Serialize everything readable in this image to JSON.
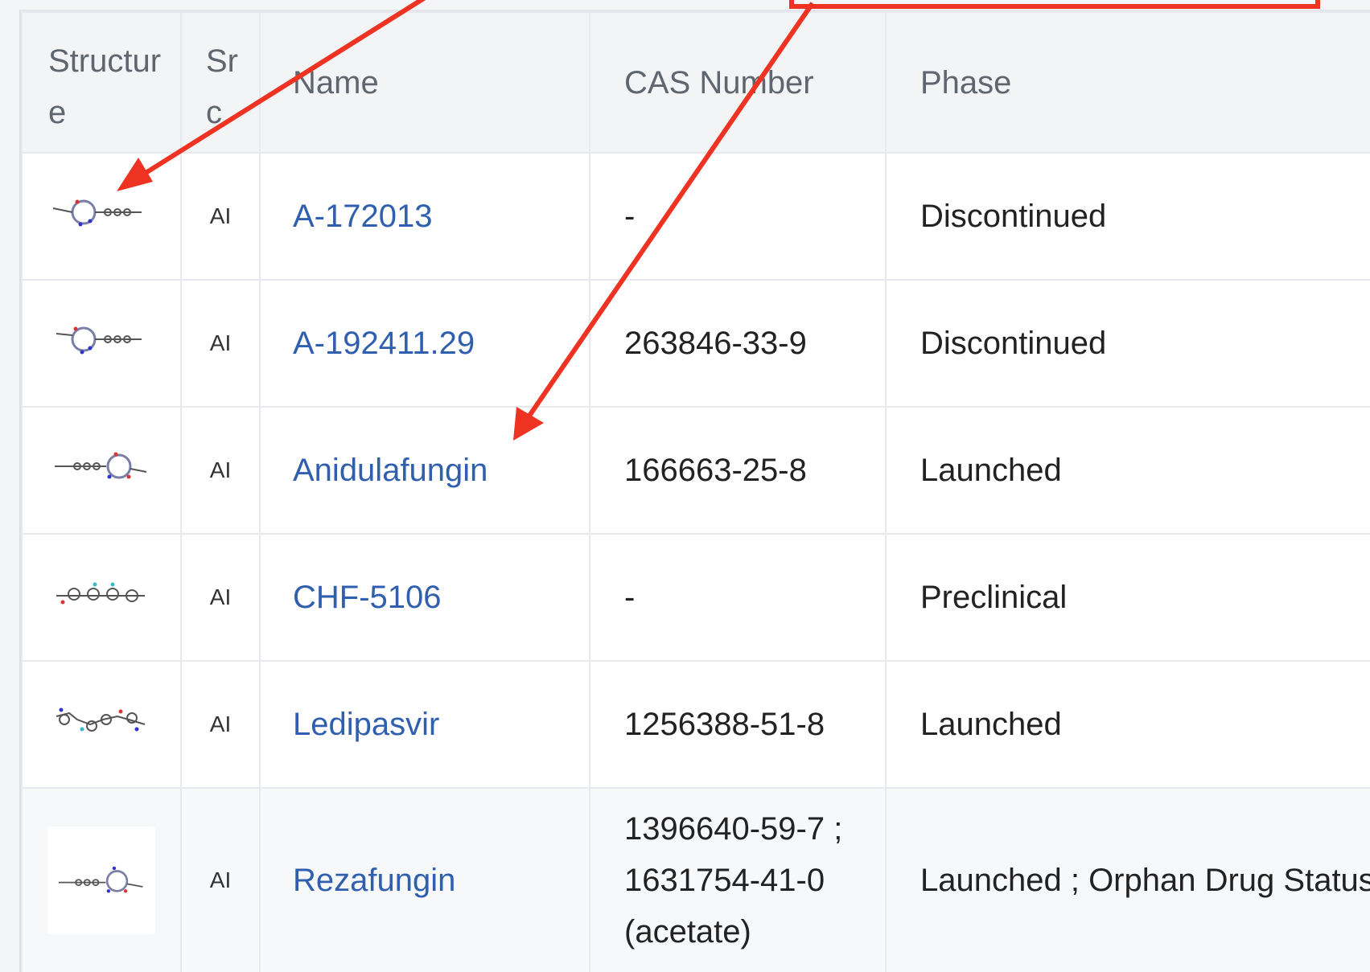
{
  "table": {
    "headers": {
      "structure": "Structure",
      "src": "Src",
      "name": "Name",
      "cas": "CAS Number",
      "phase": "Phase"
    },
    "rows": [
      {
        "src": "AI",
        "name": "A-172013",
        "cas": "-",
        "phase": "Discontinued"
      },
      {
        "src": "AI",
        "name": "A-192411.29",
        "cas": "263846-33-9",
        "phase": "Discontinued"
      },
      {
        "src": "AI",
        "name": "Anidulafungin",
        "cas": "166663-25-8",
        "phase": "Launched"
      },
      {
        "src": "AI",
        "name": "CHF-5106",
        "cas": "-",
        "phase": "Preclinical"
      },
      {
        "src": "AI",
        "name": "Ledipasvir",
        "cas": "1256388-51-8",
        "phase": "Launched"
      },
      {
        "src": "AI",
        "name": "Rezafungin",
        "cas": "1396640-59-7 ; 1631754-41-0 (acetate)",
        "phase": "Launched ; Orphan Drug Status"
      }
    ]
  },
  "annotation": {
    "arrow_color": "#ee3322",
    "box_color": "#ee3322"
  }
}
